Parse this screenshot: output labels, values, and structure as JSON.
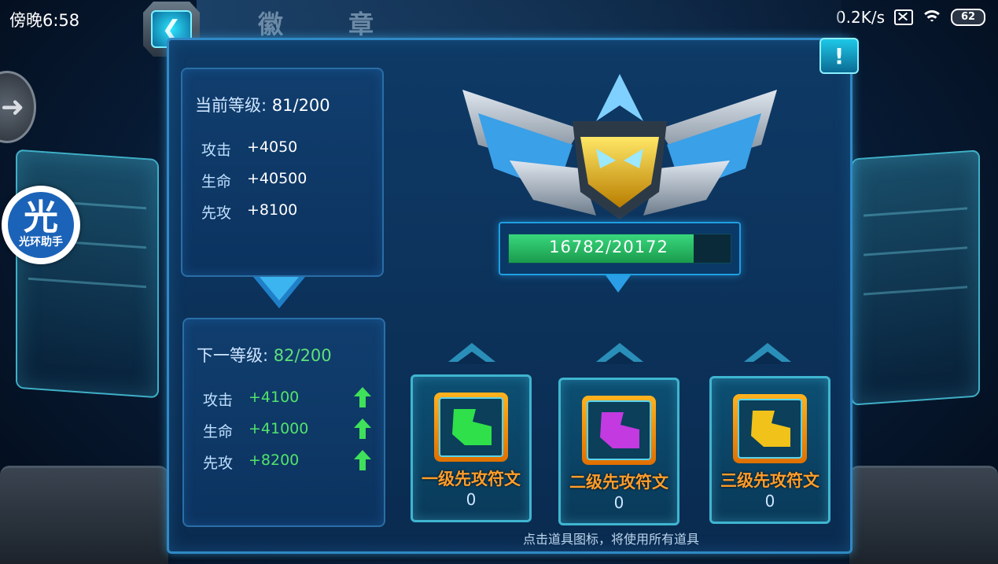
{
  "status_bar": {
    "time": "傍晚6:58",
    "network_speed": "0.2K/s",
    "battery": "62"
  },
  "header": {
    "title": "徽 章",
    "back_icon": "chevron-left-icon",
    "alert_icon": "exclamation-icon"
  },
  "assistant": {
    "glyph": "光",
    "label": "光环助手"
  },
  "current_level": {
    "label": "当前等级:",
    "value": "81/200",
    "stats": [
      {
        "name": "攻击",
        "value": "+4050"
      },
      {
        "name": "生命",
        "value": "+40500"
      },
      {
        "name": "先攻",
        "value": "+8100"
      }
    ]
  },
  "next_level": {
    "label": "下一等级:",
    "value": "82/200",
    "stats": [
      {
        "name": "攻击",
        "value": "+4100"
      },
      {
        "name": "生命",
        "value": "+41000"
      },
      {
        "name": "先攻",
        "value": "+8200"
      }
    ]
  },
  "experience": {
    "text": "16782/20172",
    "current": 16782,
    "max": 20172
  },
  "items": [
    {
      "name": "一级先攻符文",
      "count": "0",
      "color": "#2fe04a"
    },
    {
      "name": "二级先攻符文",
      "count": "0",
      "color": "#c23ae0"
    },
    {
      "name": "三级先攻符文",
      "count": "0",
      "color": "#f0c21a"
    }
  ],
  "hint": "点击道具图标，将使用所有道具",
  "colors": {
    "accent": "#2f89c6",
    "stat_up": "#52e36c",
    "item_label": "#ff9d2a"
  }
}
